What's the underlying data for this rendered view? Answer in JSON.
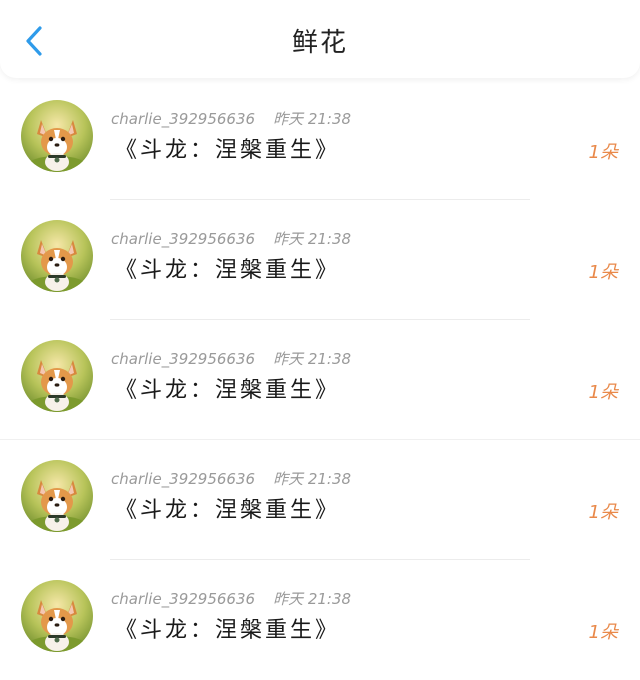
{
  "header": {
    "title": "鲜花",
    "back_icon": "chevron-left-icon",
    "accent_color": "#2f9bea"
  },
  "items": [
    {
      "username": "charlie_392956636",
      "time": "昨天 21:38",
      "book": "《斗龙：涅槃重生》",
      "count": "1朵"
    },
    {
      "username": "charlie_392956636",
      "time": "昨天 21:38",
      "book": "《斗龙：涅槃重生》",
      "count": "1朵"
    },
    {
      "username": "charlie_392956636",
      "time": "昨天 21:38",
      "book": "《斗龙：涅槃重生》",
      "count": "1朵"
    },
    {
      "username": "charlie_392956636",
      "time": "昨天 21:38",
      "book": "《斗龙：涅槃重生》",
      "count": "1朵"
    },
    {
      "username": "charlie_392956636",
      "time": "昨天 21:38",
      "book": "《斗龙：涅槃重生》",
      "count": "1朵"
    }
  ],
  "avatar_icon": "corgi-avatar-icon",
  "count_color": "#e9894a"
}
